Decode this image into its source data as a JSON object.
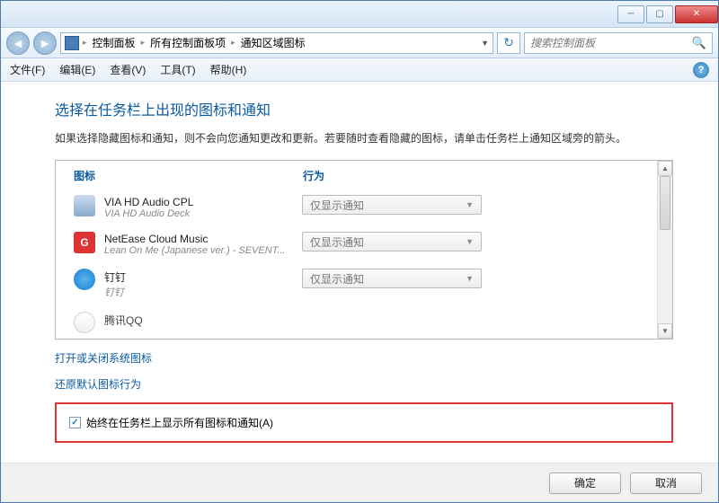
{
  "titlebar": {},
  "nav": {
    "breadcrumbs": [
      "控制面板",
      "所有控制面板项",
      "通知区域图标"
    ],
    "search_placeholder": "搜索控制面板"
  },
  "menubar": {
    "items": [
      "文件(F)",
      "编辑(E)",
      "查看(V)",
      "工具(T)",
      "帮助(H)"
    ]
  },
  "page": {
    "title": "选择在任务栏上出现的图标和通知",
    "description": "如果选择隐藏图标和通知，则不会向您通知更改和更新。若要随时查看隐藏的图标，请单击任务栏上通知区域旁的箭头。",
    "header_icon": "图标",
    "header_behavior": "行为",
    "rows": [
      {
        "name": "VIA HD Audio CPL",
        "sub": "VIA HD Audio Deck",
        "behavior": "仅显示通知",
        "icon": "via"
      },
      {
        "name": "NetEase Cloud Music",
        "sub": "Lean On Me (Japanese ver.) - SEVENT...",
        "behavior": "仅显示通知",
        "icon": "netease"
      },
      {
        "name": "钉钉",
        "sub": "钉钉",
        "behavior": "仅显示通知",
        "icon": "ding"
      },
      {
        "name": "腾讯QQ",
        "sub": "",
        "behavior": "",
        "icon": "qq"
      }
    ],
    "link_sysicons": "打开或关闭系统图标",
    "link_restore": "还原默认图标行为",
    "checkbox_label": "始终在任务栏上显示所有图标和通知(A)",
    "checkbox_checked": true
  },
  "footer": {
    "ok": "确定",
    "cancel": "取消"
  }
}
